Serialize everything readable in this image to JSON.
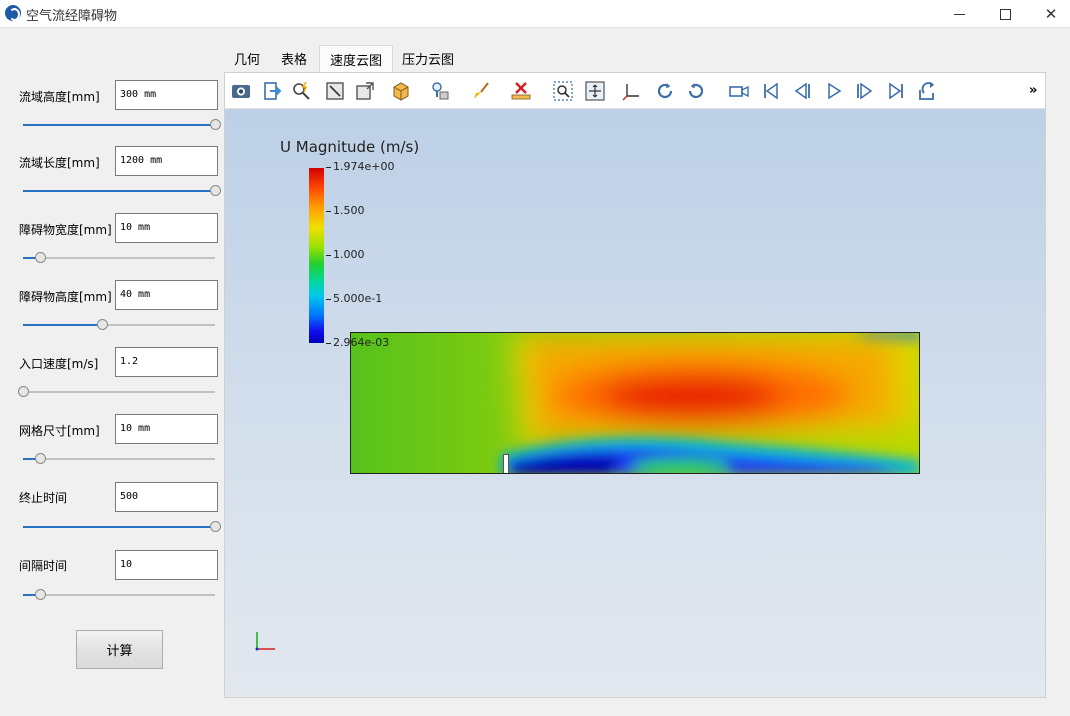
{
  "window": {
    "title": "空气流经障碍物",
    "minimize": "—",
    "maximize": "☐",
    "close": "✕"
  },
  "params": [
    {
      "label": "流域高度[mm]",
      "value": "300 mm",
      "slider": 1.0
    },
    {
      "label": "流域长度[mm]",
      "value": "1200 mm",
      "slider": 1.0
    },
    {
      "label": "障碍物宽度[mm]",
      "value": "10 mm",
      "slider": 0.09
    },
    {
      "label": "障碍物高度[mm]",
      "value": "40 mm",
      "slider": 0.41
    },
    {
      "label": "入口速度[m/s]",
      "value": "1.2",
      "slider": 0.0
    },
    {
      "label": "网格尺寸[mm]",
      "value": "10 mm",
      "slider": 0.09
    },
    {
      "label": "终止时间",
      "value": "500",
      "slider": 1.0
    },
    {
      "label": "间隔时间",
      "value": "10",
      "slider": 0.09
    }
  ],
  "calc_button": "计算",
  "tabs": [
    {
      "label": "几何",
      "active": false
    },
    {
      "label": "表格",
      "active": false
    },
    {
      "label": "速度云图",
      "active": true
    },
    {
      "label": "压力云图",
      "active": false
    }
  ],
  "toolbar": {
    "icons": [
      "camera-icon",
      "export-icon",
      "zoom-query-icon",
      "reset-view-icon",
      "box-view-icon",
      "cube-faces-icon",
      "probe-icon",
      "brush-icon",
      "ruler-icon",
      "zoom-box-icon",
      "fit-view-icon",
      "axes-orient-icon",
      "rotate-cw-icon",
      "rotate-ccw-icon",
      "video-camera-icon",
      "first-frame-icon",
      "prev-frame-icon",
      "play-icon",
      "next-frame-icon",
      "last-frame-icon",
      "loop-icon"
    ],
    "overflow": "»"
  },
  "legend": {
    "title": "U Magnitude (m/s)",
    "labels": [
      "1.974e+00",
      "1.500",
      "1.000",
      "5.000e-1",
      "2.964e-03"
    ],
    "colors": {
      "max": "#d40000",
      "mid": "#20d030",
      "min": "#0000b8"
    }
  },
  "colors": {
    "accent": "#2a73c4",
    "background": "#f0f0f0"
  }
}
